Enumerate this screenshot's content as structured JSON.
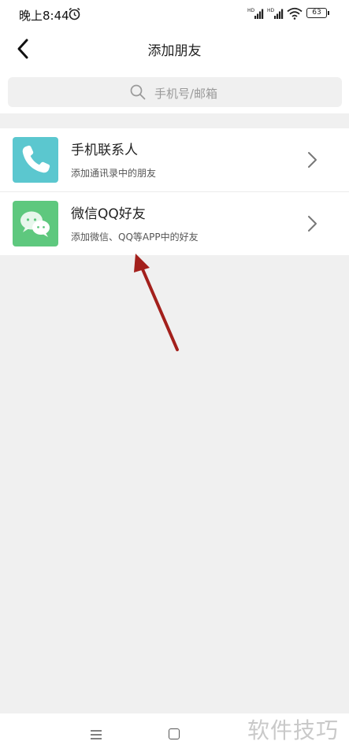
{
  "status_bar": {
    "time": "晚上8:44",
    "battery": "63",
    "icons": [
      "alarm-icon",
      "signal-hd-icon",
      "signal-hd-icon",
      "wifi-icon",
      "battery-icon"
    ]
  },
  "header": {
    "title": "添加朋友",
    "back_icon": "chevron-left-icon"
  },
  "search": {
    "placeholder": "手机号/邮箱",
    "icon": "search-icon"
  },
  "list": [
    {
      "title": "手机联系人",
      "subtitle": "添加通讯录中的朋友",
      "icon": "phone-icon",
      "icon_color": "#5bc7cf"
    },
    {
      "title": "微信QQ好友",
      "subtitle": "添加微信、QQ等APP中的好友",
      "icon": "chat-bubbles-icon",
      "icon_color": "#5ec87e"
    }
  ],
  "annotation": {
    "color": "#a3201c"
  },
  "bottom_nav": {
    "icons": [
      "menu-icon",
      "home-square-icon"
    ]
  },
  "watermark": "软件技巧"
}
